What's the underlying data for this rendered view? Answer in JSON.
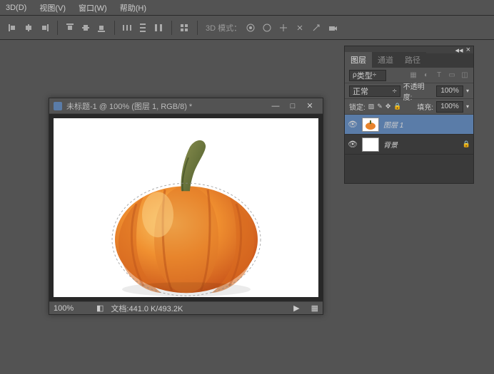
{
  "menu": {
    "m3d": "3D(D)",
    "view": "视图(V)",
    "window": "窗口(W)",
    "help": "帮助(H)"
  },
  "toolbar": {
    "mode_label": "3D 模式："
  },
  "doc": {
    "title": "未标题-1 @ 100% (图层 1, RGB/8) *",
    "zoom": "100%",
    "file_info": "文档:441.0 K/493.2K"
  },
  "panels": {
    "tabs": {
      "layers": "图层",
      "channels": "通道",
      "paths": "路径"
    },
    "type_label": "类型",
    "blend_mode": "正常",
    "opacity_label": "不透明度:",
    "opacity_value": "100%",
    "lock_label": "锁定:",
    "fill_label": "填充:",
    "fill_value": "100%",
    "layers": [
      {
        "name": "图层 1"
      },
      {
        "name": "背景"
      }
    ]
  }
}
